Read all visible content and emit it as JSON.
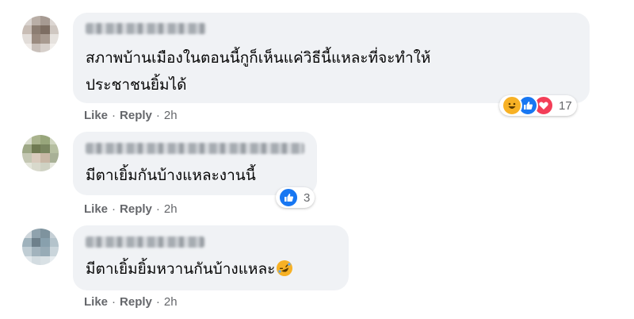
{
  "comments": [
    {
      "text_lines": [
        "สภาพบ้านเมืองในตอนนี้กูก็เห็นแค่วิธีนี้แหละที่จะทำให้",
        "ประชาชนยิ้มได้"
      ],
      "actions": {
        "like": "Like",
        "reply": "Reply",
        "time": "2h",
        "sep": "·"
      },
      "reactions": {
        "icons": [
          "haha-icon",
          "like-icon",
          "love-icon"
        ],
        "count": "17"
      }
    },
    {
      "text_lines": [
        "มีตาเยิ้มกันบ้างแหละงานนี้"
      ],
      "actions": {
        "like": "Like",
        "reply": "Reply",
        "time": "2h",
        "sep": "·"
      },
      "reactions": {
        "icons": [
          "like-icon"
        ],
        "count": "3"
      }
    },
    {
      "text_lines": [
        "มีตาเยิ้มยิ้มหวานกันบ้างแหละ"
      ],
      "trailing_emoji": "rofl-emoji",
      "actions": {
        "like": "Like",
        "reply": "Reply",
        "time": "2h",
        "sep": "·"
      }
    }
  ],
  "colors": {
    "bubble": "#f0f2f5",
    "meta": "#65676b",
    "like_blue": "#1877f2",
    "love_red": "#f33e58",
    "haha_yellow": "#f7b125"
  }
}
